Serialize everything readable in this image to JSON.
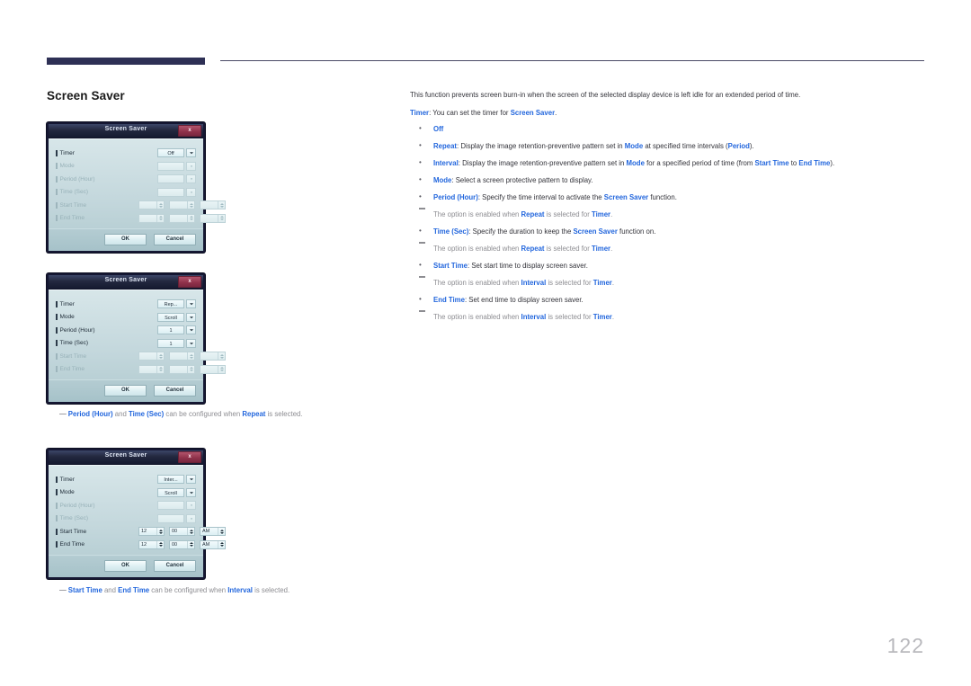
{
  "page": {
    "heading": "Screen Saver",
    "number": "122"
  },
  "dialogs": [
    {
      "title": "Screen Saver",
      "close_label": "x",
      "rows": [
        {
          "label": "Timer",
          "type": "combo",
          "value": "Off",
          "disabled": false
        },
        {
          "label": "Mode",
          "type": "combo",
          "value": "",
          "disabled": true
        },
        {
          "label": "Period (Hour)",
          "type": "combo",
          "value": "",
          "disabled": true
        },
        {
          "label": "Time (Sec)",
          "type": "combo",
          "value": "",
          "disabled": true
        },
        {
          "label": "Start Time",
          "type": "spin",
          "hour": "",
          "minute": "",
          "meridiem": "",
          "disabled": true
        },
        {
          "label": "End Time",
          "type": "spin",
          "hour": "",
          "minute": "",
          "meridiem": "",
          "disabled": true
        }
      ],
      "ok_label": "OK",
      "cancel_label": "Cancel"
    },
    {
      "title": "Screen Saver",
      "close_label": "x",
      "rows": [
        {
          "label": "Timer",
          "type": "combo",
          "value": "Rep...",
          "disabled": false
        },
        {
          "label": "Mode",
          "type": "combo",
          "value": "Scroll",
          "disabled": false
        },
        {
          "label": "Period (Hour)",
          "type": "combo",
          "value": "1",
          "disabled": false
        },
        {
          "label": "Time (Sec)",
          "type": "combo",
          "value": "1",
          "disabled": false
        },
        {
          "label": "Start Time",
          "type": "spin",
          "hour": "",
          "minute": "",
          "meridiem": "",
          "disabled": true
        },
        {
          "label": "End Time",
          "type": "spin",
          "hour": "",
          "minute": "",
          "meridiem": "",
          "disabled": true
        }
      ],
      "ok_label": "OK",
      "cancel_label": "Cancel"
    },
    {
      "title": "Screen Saver",
      "close_label": "x",
      "rows": [
        {
          "label": "Timer",
          "type": "combo",
          "value": "Inter...",
          "disabled": false
        },
        {
          "label": "Mode",
          "type": "combo",
          "value": "Scroll",
          "disabled": false
        },
        {
          "label": "Period (Hour)",
          "type": "combo",
          "value": "",
          "disabled": true
        },
        {
          "label": "Time (Sec)",
          "type": "combo",
          "value": "",
          "disabled": true
        },
        {
          "label": "Start Time",
          "type": "spin",
          "hour": "12",
          "minute": "00",
          "meridiem": "AM",
          "disabled": false
        },
        {
          "label": "End Time",
          "type": "spin",
          "hour": "12",
          "minute": "00",
          "meridiem": "AM",
          "disabled": false
        }
      ],
      "ok_label": "OK",
      "cancel_label": "Cancel"
    }
  ],
  "notes": {
    "repeat_note_html": "<span class=\"dash\">—</span><b>Period (Hour)</b> and <b>Time (Sec)</b> can be configured when <b>Repeat</b> is selected.",
    "interval_note_html": "<span class=\"dash\">—</span><b>Start Time</b> and <b>End Time</b> can be configured when <b>Interval</b> is selected."
  },
  "content": {
    "lead_html": "This function prevents screen burn-in when the screen of the selected display device is left idle for an extended period of time.",
    "timer_html": "<b>Timer</b>: You can set the timer for <b>Screen Saver</b>.",
    "bullets": [
      {
        "html": "<b>Off</b>"
      },
      {
        "html": "<b>Repeat</b>: Display the image retention-preventive pattern set in <b>Mode</b> at specified time intervals (<b>Period</b>)."
      },
      {
        "html": "<b>Interval</b>: Display the image retention-preventive pattern set in <b>Mode</b> for a specified period of time (from <b>Start Time</b> to <b>End Time</b>)."
      },
      {
        "html": "<b>Mode</b>: Select a screen protective pattern to display."
      },
      {
        "html": "<b>Period (Hour)</b>: Specify the time interval to activate the <b>Screen Saver</b> function."
      },
      {
        "html": "The option is enabled when <b>Repeat</b> is selected for <b>Timer</b>.",
        "sub": true
      },
      {
        "html": "<b>Time (Sec)</b>: Specify the duration to keep the <b>Screen Saver</b> function on."
      },
      {
        "html": "The option is enabled when <b>Repeat</b> is selected for <b>Timer</b>.",
        "sub": true
      },
      {
        "html": "<b>Start Time</b>: Set start time to display screen saver."
      },
      {
        "html": "The option is enabled when <b>Interval</b> is selected for <b>Timer</b>.",
        "sub": true
      },
      {
        "html": "<b>End Time</b>: Set end time to display screen saver."
      },
      {
        "html": "The option is enabled when <b>Interval</b> is selected for <b>Timer</b>.",
        "sub": true
      }
    ]
  },
  "colors": {
    "accent_blue": "#2266dd",
    "header_bar": "#2e3055",
    "dialog_titlebar": "#23283f",
    "dialog_body": "#c3d7dc",
    "close_button": "#8e3049"
  }
}
